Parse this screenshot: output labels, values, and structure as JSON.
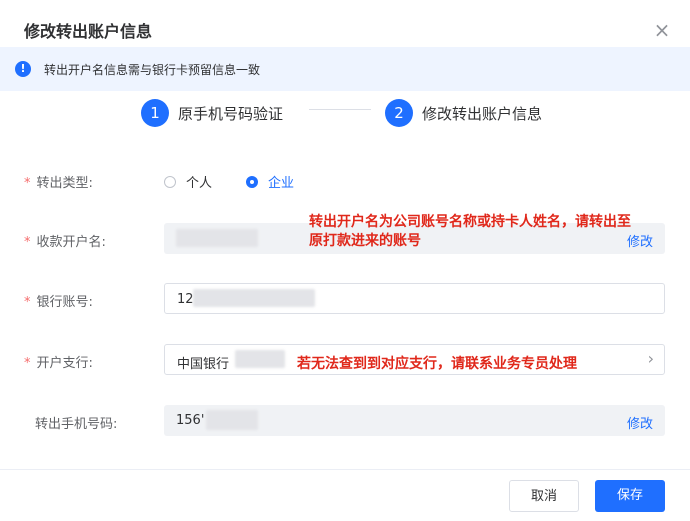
{
  "dialog": {
    "title": "修改转出账户信息",
    "close": "×"
  },
  "notice": {
    "icon": "info-icon",
    "text": "转出开户名信息需与银行卡预留信息一致"
  },
  "steps": [
    {
      "number": "1",
      "label": "原手机号码验证"
    },
    {
      "number": "2",
      "label": "修改转出账户信息"
    }
  ],
  "form": {
    "required_mark": "*",
    "type_label": "转出类型:",
    "type_options": [
      "个人",
      "企业"
    ],
    "type_selected": "企业",
    "payee_label": "收款开户名:",
    "payee_edit": "修改",
    "account_label": "银行账号:",
    "account_value": "12",
    "branch_label": "开户支行:",
    "branch_value": "中国银行",
    "phone_label": "转出手机号码:",
    "phone_value": "156'",
    "phone_edit": "修改"
  },
  "annotations": {
    "payee_note_line1": "转出开户名为公司账号名称或持卡人姓名，请转出至",
    "payee_note_line2": "原打款进来的账号",
    "branch_note": "若无法查到到对应支行，请联系业务专员处理"
  },
  "footer": {
    "cancel": "取消",
    "save": "保存"
  },
  "colors": {
    "accent": "#1f6fff",
    "annotation": "#e0281b",
    "required": "#f56c6c"
  }
}
